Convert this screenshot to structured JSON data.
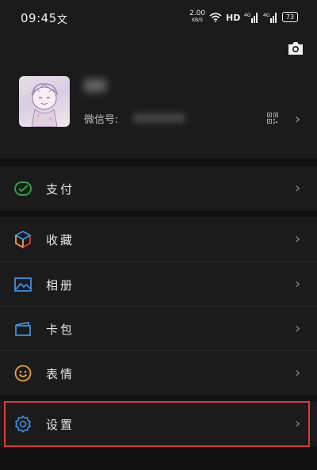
{
  "status_bar": {
    "time": "09:45",
    "notification_glyph": "文",
    "speed_value": "2.00",
    "speed_unit": "KB/S",
    "hd_label": "HD",
    "network_1": "4G",
    "network_2": "4G",
    "battery": "73"
  },
  "profile": {
    "wechat_id_label": "微信号:"
  },
  "menu": {
    "pay": "支付",
    "favorites": "收藏",
    "album": "相册",
    "cards": "卡包",
    "stickers": "表情",
    "settings": "设置"
  },
  "colors": {
    "accent_green": "#2ba245",
    "accent_blue": "#3d8fe0",
    "accent_orange": "#f0a43a",
    "highlight_red": "#e0383f"
  }
}
